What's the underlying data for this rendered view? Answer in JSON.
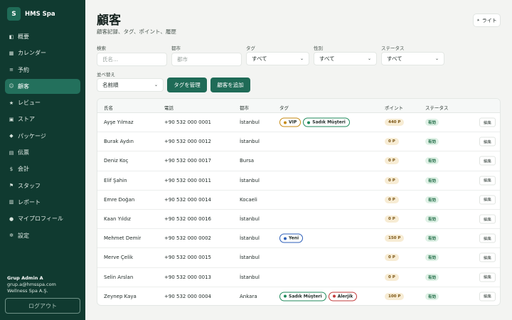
{
  "brand": {
    "logo_letter": "S",
    "name": "HMS Spa"
  },
  "nav": [
    {
      "label": "概要",
      "icon": "overview-icon",
      "glyph": "◧"
    },
    {
      "label": "カレンダー",
      "icon": "calendar-icon",
      "glyph": "▦"
    },
    {
      "label": "予約",
      "icon": "list-icon",
      "glyph": "≡"
    },
    {
      "label": "顧客",
      "icon": "customers-icon",
      "glyph": "☺",
      "active": true
    },
    {
      "label": "レビュー",
      "icon": "star-icon",
      "glyph": "★"
    },
    {
      "label": "ストア",
      "icon": "store-icon",
      "glyph": "▣"
    },
    {
      "label": "パッケージ",
      "icon": "package-icon",
      "glyph": "◆"
    },
    {
      "label": "伝票",
      "icon": "receipt-icon",
      "glyph": "▤"
    },
    {
      "label": "会計",
      "icon": "money-bag-icon",
      "glyph": "$"
    },
    {
      "label": "スタッフ",
      "icon": "flag-icon",
      "glyph": "⚑"
    },
    {
      "label": "レポート",
      "icon": "report-icon",
      "glyph": "▥"
    },
    {
      "label": "マイプロフィール",
      "icon": "profile-icon",
      "glyph": "●"
    },
    {
      "label": "設定",
      "icon": "gear-icon",
      "glyph": "✲"
    }
  ],
  "user": {
    "name": "Grup Admin A",
    "email": "grup.a@hmsspa.com",
    "company": "Wellness Spa A.Ş."
  },
  "logout_label": "ログアウト",
  "header": {
    "title": "顧客",
    "subtitle": "顧客記録、タグ、ポイント、履歴",
    "theme_label": "ライト"
  },
  "filters": {
    "search_label": "検索",
    "search_placeholder": "氏名...",
    "city_label": "都市",
    "city_placeholder": "都市",
    "tag_label": "タグ",
    "tag_value": "すべて",
    "gender_label": "性別",
    "gender_value": "すべて",
    "status_label": "ステータス",
    "status_value": "すべて",
    "sort_label": "並べ替え",
    "sort_value": "名前順",
    "manage_tags_label": "タグを管理",
    "add_customer_label": "顧客を追加"
  },
  "table": {
    "columns": [
      "氏名",
      "電話",
      "都市",
      "タグ",
      "ポイント",
      "ステータス"
    ],
    "edit_label": "編集",
    "rows": [
      {
        "name": "Ayşe Yılmaz",
        "phone": "+90 532 000 0001",
        "city": "İstanbul",
        "tags": [
          {
            "label": "VIP",
            "color": "#c58a12"
          },
          {
            "label": "Sadık Müşteri",
            "color": "#1f8a5b"
          }
        ],
        "points": "440 P",
        "status": "有効"
      },
      {
        "name": "Burak Aydın",
        "phone": "+90 532 000 0012",
        "city": "İstanbul",
        "tags": [],
        "points": "0 P",
        "status": "有効"
      },
      {
        "name": "Deniz Koç",
        "phone": "+90 532 000 0017",
        "city": "Bursa",
        "tags": [],
        "points": "0 P",
        "status": "有効"
      },
      {
        "name": "Elif Şahin",
        "phone": "+90 532 000 0011",
        "city": "İstanbul",
        "tags": [],
        "points": "0 P",
        "status": "有効"
      },
      {
        "name": "Emre Doğan",
        "phone": "+90 532 000 0014",
        "city": "Kocaeli",
        "tags": [],
        "points": "0 P",
        "status": "有効"
      },
      {
        "name": "Kaan Yıldız",
        "phone": "+90 532 000 0016",
        "city": "İstanbul",
        "tags": [],
        "points": "0 P",
        "status": "有効"
      },
      {
        "name": "Mehmet Demir",
        "phone": "+90 532 000 0002",
        "city": "İstanbul",
        "tags": [
          {
            "label": "Yeni",
            "color": "#2d5fb8"
          }
        ],
        "points": "150 P",
        "status": "有効"
      },
      {
        "name": "Merve Çelik",
        "phone": "+90 532 000 0015",
        "city": "İstanbul",
        "tags": [],
        "points": "0 P",
        "status": "有効"
      },
      {
        "name": "Selin Arslan",
        "phone": "+90 532 000 0013",
        "city": "İstanbul",
        "tags": [],
        "points": "0 P",
        "status": "有効"
      },
      {
        "name": "Zeynep Kaya",
        "phone": "+90 532 000 0004",
        "city": "Ankara",
        "tags": [
          {
            "label": "Sadık Müşteri",
            "color": "#1f8a5b"
          },
          {
            "label": "Alerjik",
            "color": "#c23b3b"
          }
        ],
        "points": "100 P",
        "status": "有効"
      }
    ]
  }
}
